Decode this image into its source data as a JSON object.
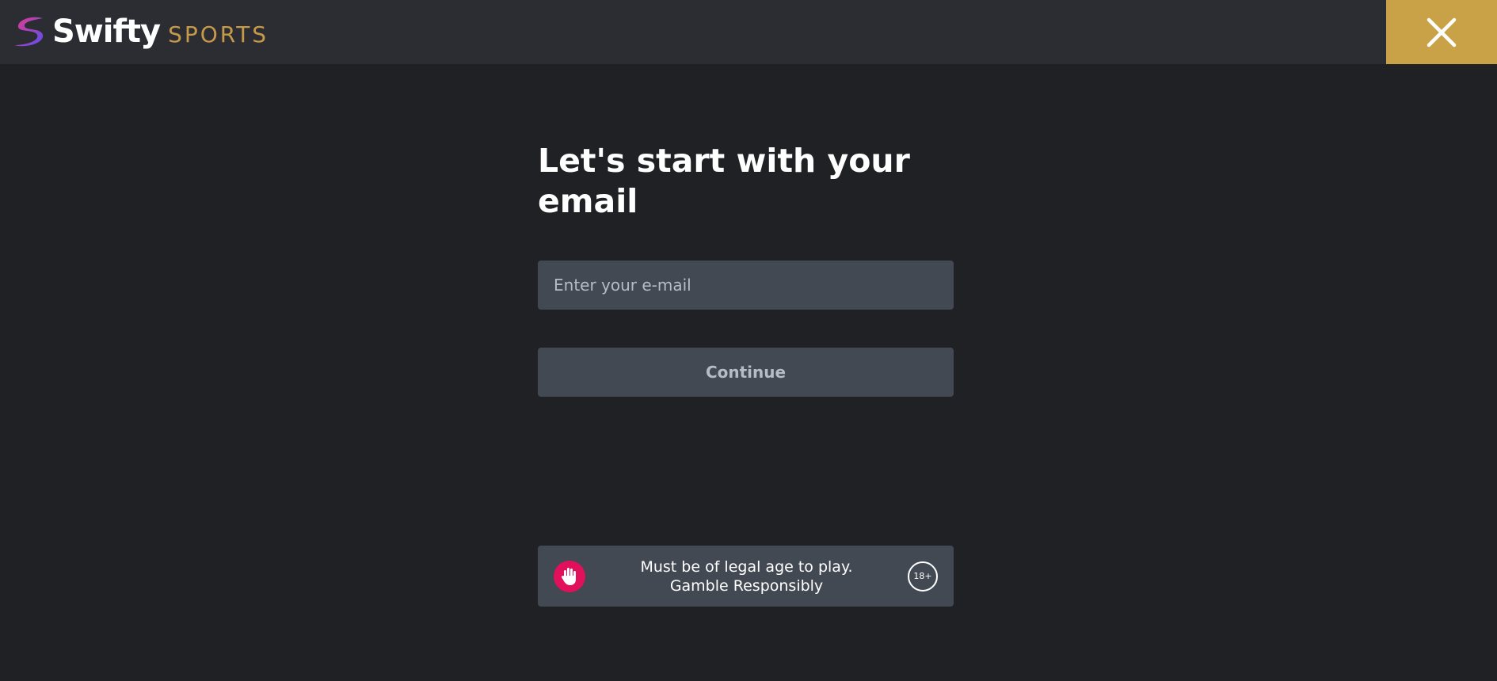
{
  "header": {
    "brand_name": "Swifty",
    "brand_sub": "SPORTS",
    "logo_icon": "swifty-swoosh-icon",
    "close_icon": "close-icon",
    "colors": {
      "background": "#2b2d33",
      "brand_sub": "#c69a48",
      "close_button": "#c9a247"
    }
  },
  "main": {
    "title": "Let's start with your email",
    "email_input": {
      "value": "",
      "placeholder": "Enter your e-mail"
    },
    "continue_label": "Continue"
  },
  "notice": {
    "icon": "hand-stop-icon",
    "line1": "Must be of legal age to play.",
    "line2": "Gamble Responsibly",
    "age_badge": "18+",
    "colors": {
      "stop_icon_bg": "#e0105a"
    }
  },
  "colors": {
    "page_background": "#202125",
    "field_background": "#434953"
  }
}
